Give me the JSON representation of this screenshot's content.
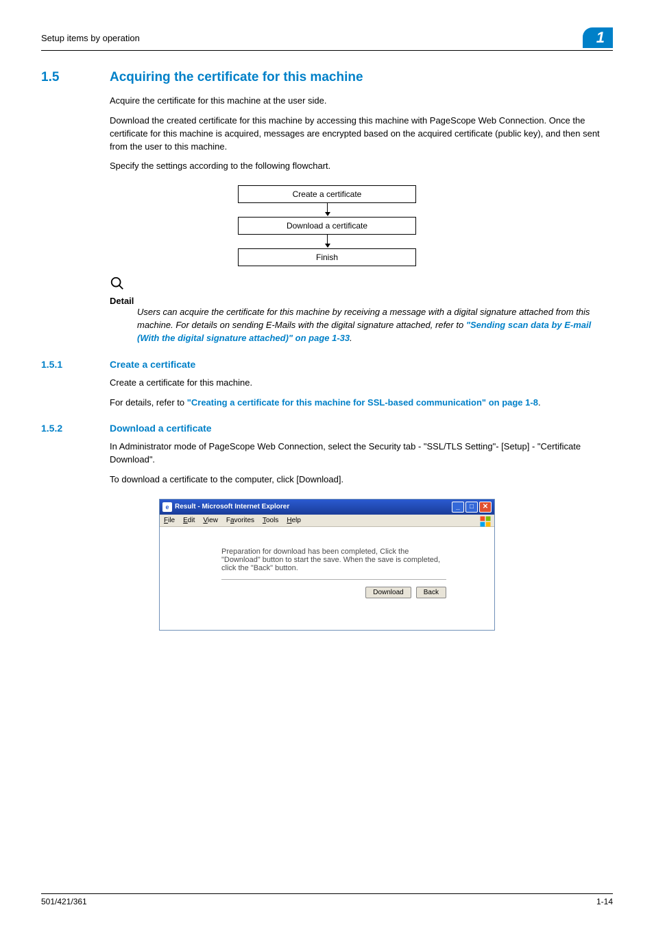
{
  "header": {
    "left": "Setup items by operation",
    "chapter": "1"
  },
  "section": {
    "num": "1.5",
    "title": "Acquiring the certificate for this machine",
    "p1": "Acquire the certificate for this machine at the user side.",
    "p2": "Download the created certificate for this machine by accessing this machine with PageScope Web Connection. Once the certificate for this machine is acquired, messages are encrypted based on the acquired certificate (public key), and then sent from the user to this machine.",
    "p3": "Specify the settings according to the following flowchart."
  },
  "flowchart": {
    "box1": "Create a certificate",
    "box2": "Download a certificate",
    "box3": "Finish"
  },
  "detail": {
    "label": "Detail",
    "text_pre": "Users can acquire the certificate for this machine by receiving a message with a digital signature attached from this machine. For details on sending E-Mails with the digital signature attached, refer to ",
    "link": "\"Sending scan data by E-mail (With the digital signature attached)\" on page 1-33",
    "text_post": "."
  },
  "sub1": {
    "num": "1.5.1",
    "title": "Create a certificate",
    "p1": "Create a certificate for this machine.",
    "p2_pre": "For details, refer to ",
    "p2_link": "\"Creating a certificate for this machine for SSL-based communication\" on page 1-8",
    "p2_post": "."
  },
  "sub2": {
    "num": "1.5.2",
    "title": "Download a certificate",
    "p1": "In Administrator mode of PageScope Web Connection, select the Security tab - \"SSL/TLS Setting\"- [Setup] - \"Certificate Download\".",
    "p2": "To download a certificate to the computer, click [Download]."
  },
  "screenshot": {
    "title": "Result - Microsoft Internet Explorer",
    "menu": {
      "file": "File",
      "edit": "Edit",
      "view": "View",
      "favorites": "Favorites",
      "tools": "Tools",
      "help": "Help"
    },
    "content_text": "Preparation for download has been completed, Click the \"Download\" button to start the save. When the save is completed, click the \"Back\" button.",
    "btn_download": "Download",
    "btn_back": "Back"
  },
  "footer": {
    "left": "501/421/361",
    "right": "1-14"
  }
}
